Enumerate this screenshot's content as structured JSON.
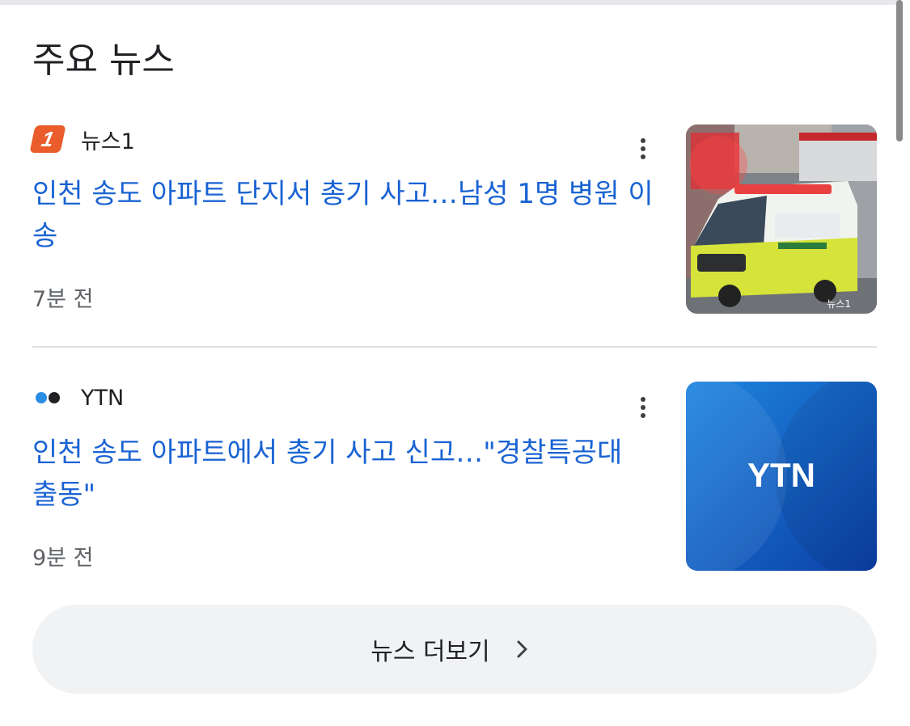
{
  "section": {
    "title": "주요 뉴스"
  },
  "articles": [
    {
      "source": "뉴스1",
      "source_logo_text": "1",
      "headline": "인천 송도 아파트 단지서 총기 사고…남성 1명 병원 이송",
      "time": "7분 전",
      "thumb_watermark": "뉴스1"
    },
    {
      "source": "YTN",
      "headline": "인천 송도 아파트에서 총기 사고 신고…\"경찰특공대 출동\"",
      "time": "9분 전",
      "thumb_text": "YTN"
    }
  ],
  "more_button": {
    "label": "뉴스 더보기"
  },
  "colors": {
    "headline": "#1a63d3",
    "news1_brand": "#ea5c2b",
    "ytn_blue": "#1565c0"
  },
  "icons": [
    "more-vert-icon",
    "chevron-right-icon"
  ]
}
